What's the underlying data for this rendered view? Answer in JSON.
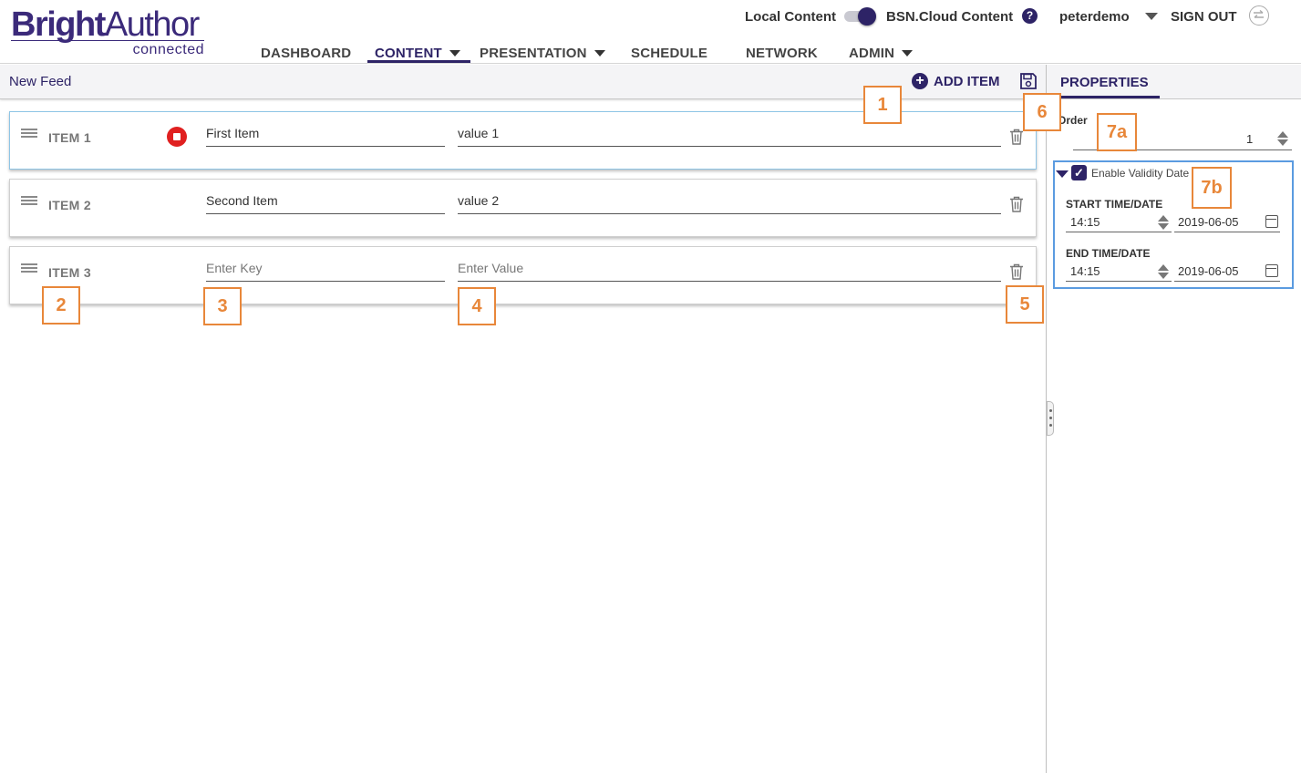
{
  "app": {
    "logo_bright": "Bright",
    "logo_author": "Author",
    "logo_sub": "connected"
  },
  "topbar": {
    "local_content": "Local Content",
    "cloud_content": "BSN.Cloud Content",
    "help_icon": "help-icon",
    "username": "peterdemo",
    "sign_out": "SIGN OUT"
  },
  "nav": {
    "dashboard": "DASHBOARD",
    "content": "CONTENT",
    "presentation": "PRESENTATION",
    "schedule": "SCHEDULE",
    "network": "NETWORK",
    "admin": "ADMIN"
  },
  "toolbar": {
    "feed_title": "New Feed",
    "add_item": "ADD ITEM"
  },
  "items": [
    {
      "label": "ITEM 1",
      "key": "First Item",
      "value": "value 1"
    },
    {
      "label": "ITEM 2",
      "key": "Second Item",
      "value": "value 2"
    },
    {
      "label": "ITEM 3",
      "key": "",
      "value": "",
      "key_placeholder": "Enter Key",
      "value_placeholder": "Enter Value"
    }
  ],
  "callouts": [
    "1",
    "2",
    "3",
    "4",
    "5",
    "6",
    "7a",
    "7b"
  ],
  "properties": {
    "tab": "PROPERTIES",
    "order_label": "Order",
    "order_value": "1",
    "enable_validity": "Enable Validity Date",
    "start_label": "START TIME/DATE",
    "start_time": "14:15",
    "start_date": "2019-06-05",
    "end_label": "END TIME/DATE",
    "end_time": "14:15",
    "end_date": "2019-06-05"
  },
  "colors": {
    "brand": "#2d2366",
    "callout": "#e8873a",
    "stop": "#e02020",
    "selection": "#8ec5e6"
  }
}
